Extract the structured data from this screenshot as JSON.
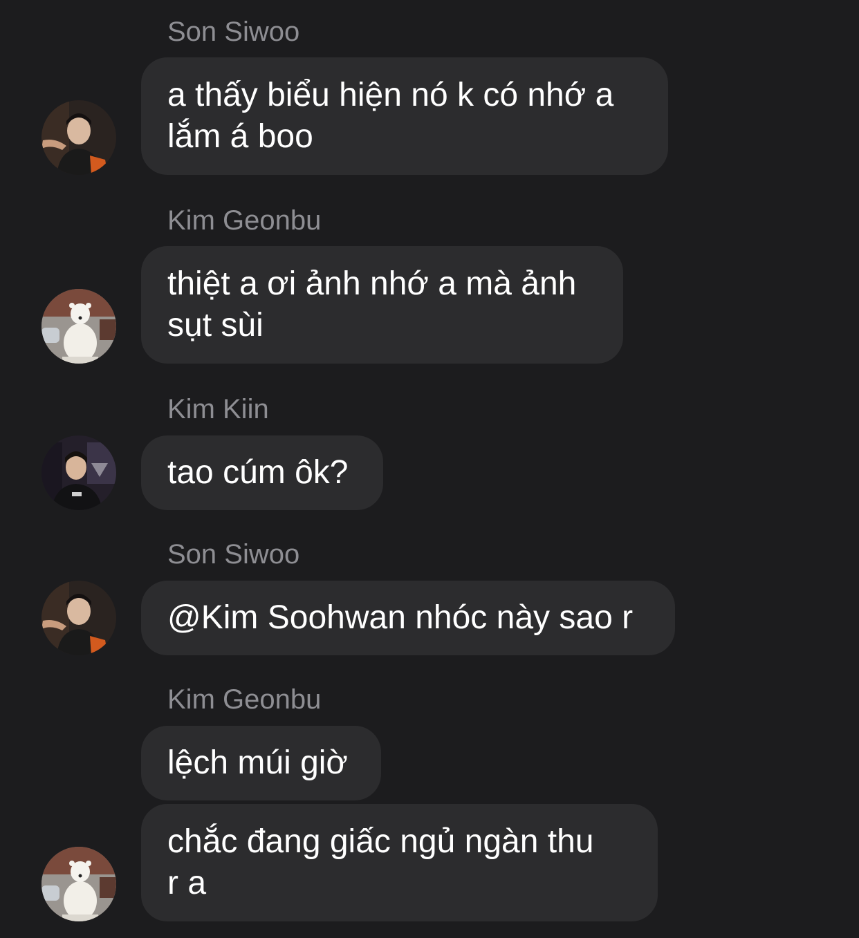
{
  "colors": {
    "background": "#1c1c1e",
    "bubble": "#2c2c2e",
    "sender_name": "#8e8e93",
    "message_text": "#ffffff"
  },
  "messages": [
    {
      "sender": "Son Siwoo",
      "avatar": "person-photo-orange-jersey-avatar",
      "text": "a thấy biểu hiện nó k có nhớ a\nlắm á boo"
    },
    {
      "sender": "Kim Geonbu",
      "avatar": "polar-bear-photo-avatar",
      "text": "thiệt a ơi ảnh nhớ a mà ảnh\nsụt sùi"
    },
    {
      "sender": "Kim Kiin",
      "avatar": "person-photo-dark-jersey-avatar",
      "text": "tao cúm ôk?"
    },
    {
      "sender": "Son Siwoo",
      "avatar": "person-photo-orange-jersey-avatar",
      "text": "@Kim Soohwan nhóc này sao r"
    },
    {
      "sender": "Kim Geonbu",
      "avatar": null,
      "text": "lệch múi giờ"
    },
    {
      "sender": null,
      "avatar": "polar-bear-photo-avatar",
      "text": "chắc đang giấc ngủ ngàn thu\nr a"
    }
  ]
}
